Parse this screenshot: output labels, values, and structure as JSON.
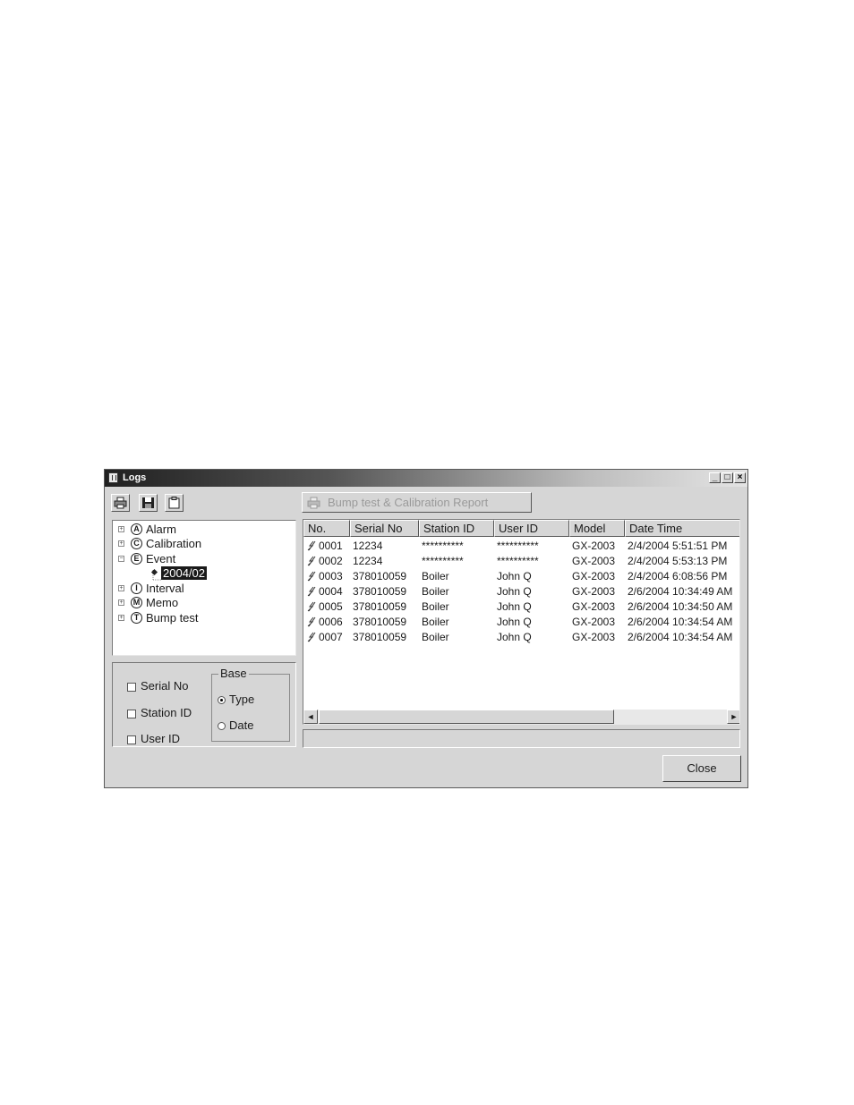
{
  "window": {
    "title": "Logs",
    "controls": {
      "minimize": "_",
      "maximize": "□",
      "close": "×"
    }
  },
  "toolbar": {
    "buttons": [
      {
        "name": "print",
        "icon": "printer-icon"
      },
      {
        "name": "save",
        "icon": "floppy-disk-icon"
      },
      {
        "name": "clipboard",
        "icon": "clipboard-icon"
      }
    ],
    "report_button_label": "Bump test & Calibration Report",
    "report_button_icon": "printer-icon"
  },
  "tree": {
    "items": [
      {
        "badge": "A",
        "label": "Alarm",
        "expander": "+"
      },
      {
        "badge": "C",
        "label": "Calibration",
        "expander": "+"
      },
      {
        "badge": "E",
        "label": "Event",
        "expander": "−",
        "child": "2004/02"
      },
      {
        "badge": "I",
        "label": "Interval",
        "expander": "+"
      },
      {
        "badge": "M",
        "label": "Memo",
        "expander": "+"
      },
      {
        "badge": "T",
        "label": "Bump test",
        "expander": "+"
      }
    ]
  },
  "options": {
    "checkboxes": [
      {
        "label": "Serial No",
        "checked": false
      },
      {
        "label": "Station ID",
        "checked": false
      },
      {
        "label": "User ID",
        "checked": false
      }
    ],
    "base_group": {
      "title": "Base",
      "radios": [
        {
          "label": "Type",
          "selected": true
        },
        {
          "label": "Date",
          "selected": false
        }
      ]
    }
  },
  "table": {
    "columns": [
      "No.",
      "Serial No",
      "Station ID",
      "User ID",
      "Model",
      "Date Time"
    ],
    "row_icon": "event-spark-icon",
    "rows": [
      [
        "0001",
        "12234",
        "**********",
        "**********",
        "GX-2003",
        "2/4/2004 5:51:51 PM"
      ],
      [
        "0002",
        "12234",
        "**********",
        "**********",
        "GX-2003",
        "2/4/2004 5:53:13 PM"
      ],
      [
        "0003",
        "378010059",
        "Boiler",
        "John Q",
        "GX-2003",
        "2/4/2004 6:08:56 PM"
      ],
      [
        "0004",
        "378010059",
        "Boiler",
        "John Q",
        "GX-2003",
        "2/6/2004 10:34:49 AM"
      ],
      [
        "0005",
        "378010059",
        "Boiler",
        "John Q",
        "GX-2003",
        "2/6/2004 10:34:50 AM"
      ],
      [
        "0006",
        "378010059",
        "Boiler",
        "John Q",
        "GX-2003",
        "2/6/2004 10:34:54 AM"
      ],
      [
        "0007",
        "378010059",
        "Boiler",
        "John Q",
        "GX-2003",
        "2/6/2004 10:34:54 AM"
      ]
    ],
    "scroll": {
      "left_arrow": "◄",
      "right_arrow": "►"
    }
  },
  "footer": {
    "close_label": "Close"
  },
  "colors": {
    "face": "#d6d6d6",
    "title_dark": "#202020",
    "selection": "#1a1a1a"
  }
}
